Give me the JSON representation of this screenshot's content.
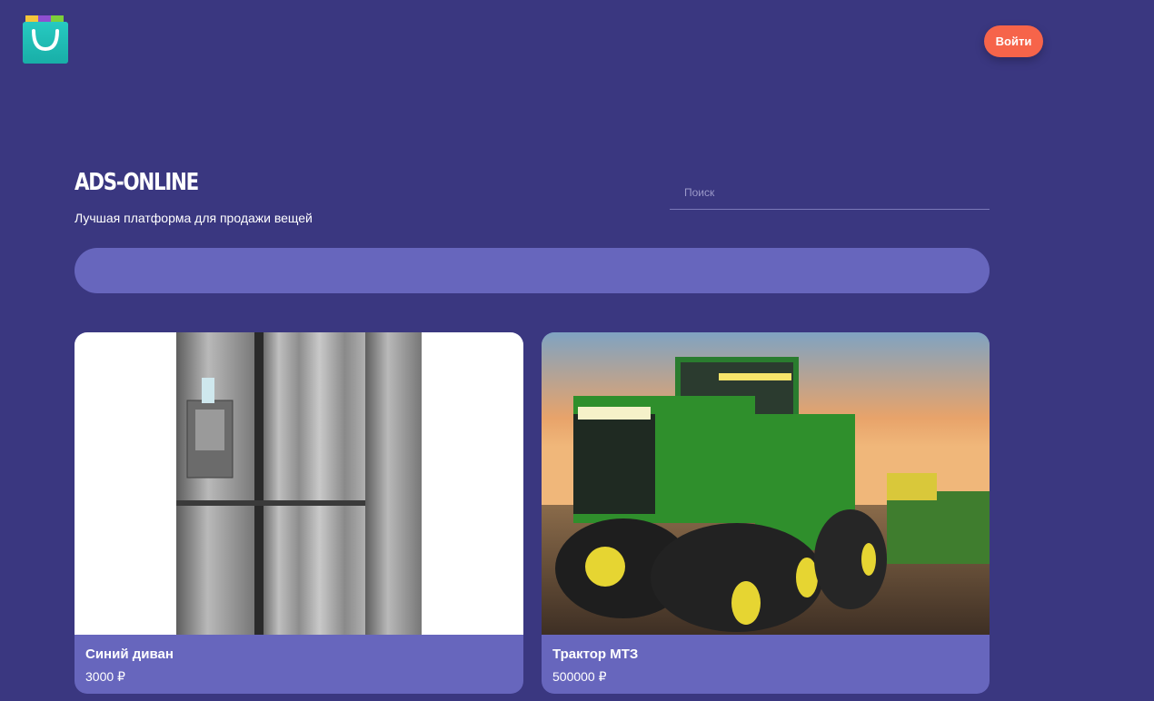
{
  "header": {
    "logo_icon": "shopping-bag-icon",
    "login_label": "Войти"
  },
  "hero": {
    "title": "ADS-ONLINE",
    "tagline": "Лучшая платформа для продажи вещей",
    "search_placeholder": "Поиск"
  },
  "colors": {
    "background": "#3a3780",
    "accent": "#f6644a",
    "card": "#6766bd"
  },
  "products": [
    {
      "title": "Синий диван",
      "price": "3000 ₽",
      "image": "refrigerator-photo"
    },
    {
      "title": "Трактор МТЗ",
      "price": "500000 ₽",
      "image": "tractor-photo"
    }
  ]
}
